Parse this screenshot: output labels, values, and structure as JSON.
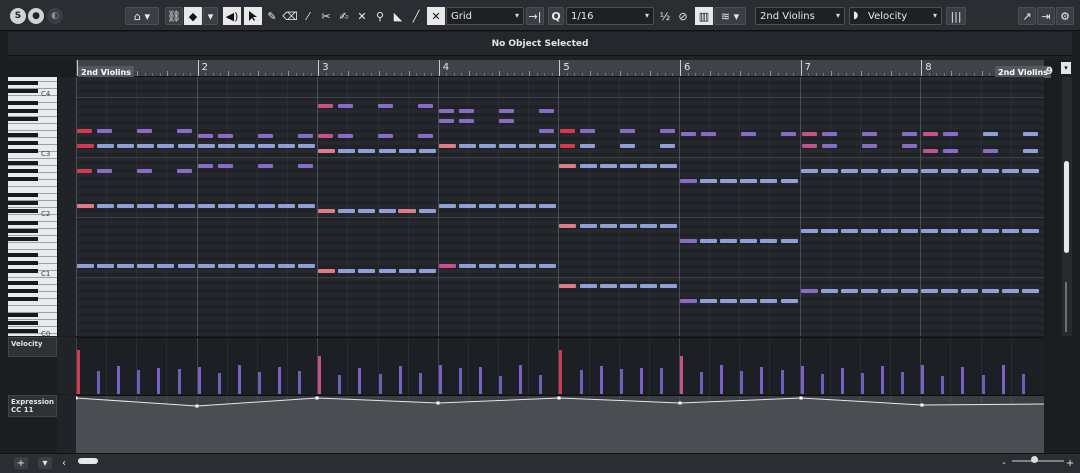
{
  "toolbar": {
    "solo_label": "S",
    "listen_label": "●",
    "grid_type": "Grid",
    "quantize_label": "Q",
    "quantize_value": "1/16",
    "instrument": "2nd Violins",
    "controller_lane": "Velocity"
  },
  "info_line": {
    "message": "No Object Selected"
  },
  "ruler": {
    "bars": [
      "2",
      "3",
      "4",
      "5",
      "6",
      "7",
      "8"
    ],
    "left_locator": "2nd Violins",
    "right_locator": "2nd Violins",
    "end_bar": "9"
  },
  "keyboard": {
    "labels": [
      "C4",
      "C3",
      "C2",
      "C1",
      "C0"
    ]
  },
  "lanes": {
    "velocity": {
      "label": "Velocity"
    },
    "expression": {
      "label_line1": "Expression",
      "label_line2": "CC 11"
    }
  },
  "colors": {
    "note_blue": "#8fa0d8",
    "note_purple": "#8a6cc7",
    "note_red": "#d63850",
    "note_pink": "#e07a86",
    "background": "#1f2226"
  },
  "icons": [
    "solo-icon",
    "listen-icon",
    "feedback-icon",
    "auto-scroll-icon",
    "link-icon",
    "select-icon",
    "draw-icon",
    "erase-icon",
    "trim-icon",
    "split-icon",
    "glue-icon",
    "mute-icon",
    "zoom-icon",
    "line-icon",
    "time-warp-icon",
    "grid-icon",
    "quantize-icon",
    "mixer-icon",
    "maximize-icon",
    "settings-icon"
  ],
  "bottom": {
    "add_label": "+",
    "menu_label": "▾"
  }
}
